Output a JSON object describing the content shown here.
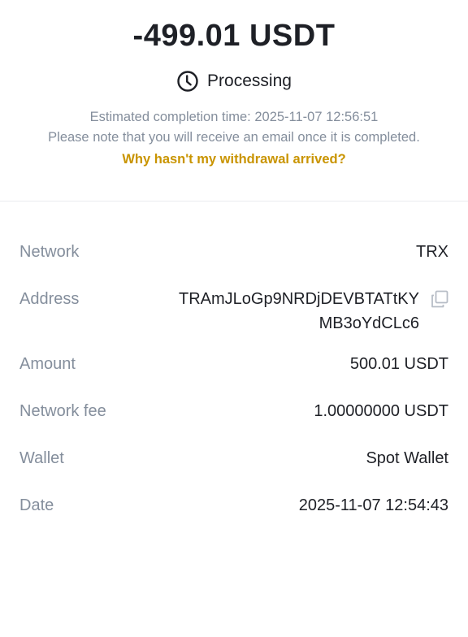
{
  "header": {
    "amount": "-499.01 USDT",
    "status": "Processing",
    "estimated_completion": "Estimated completion time: 2025-11-07 12:56:51",
    "email_note": "Please note that you will receive an email once it is completed.",
    "help_link": "Why hasn't my withdrawal arrived?"
  },
  "details": {
    "network": {
      "label": "Network",
      "value": "TRX"
    },
    "address": {
      "label": "Address",
      "line1": "TRAmJLoGp9NRDjDEVBTATtKY",
      "line2": "MB3oYdCLc6"
    },
    "amount": {
      "label": "Amount",
      "value": "500.01 USDT"
    },
    "network_fee": {
      "label": "Network fee",
      "value": "1.00000000 USDT"
    },
    "wallet": {
      "label": "Wallet",
      "value": "Spot Wallet"
    },
    "date": {
      "label": "Date",
      "value": "2025-11-07 12:54:43"
    }
  },
  "icons": {
    "status": "clock-icon",
    "copy": "copy-icon"
  },
  "colors": {
    "primary_text": "#1e2026",
    "secondary_text": "#848e9c",
    "link": "#c99400"
  }
}
